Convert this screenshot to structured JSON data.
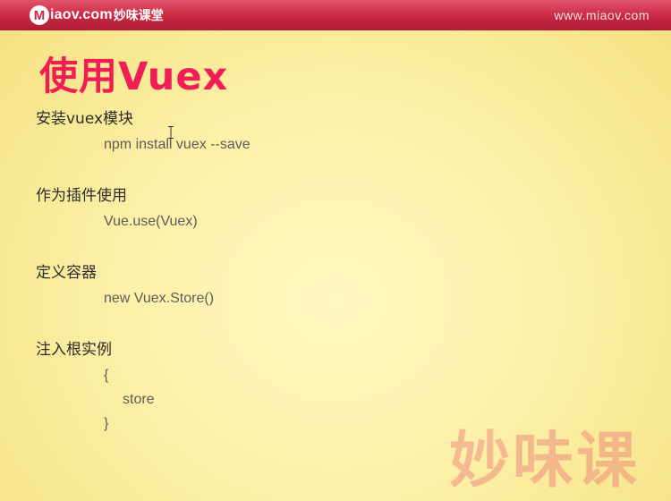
{
  "header": {
    "logo_m": "M",
    "logo_rest": "iaov.com",
    "logo_cn": "妙味课堂",
    "site_url": "www.miaov.com"
  },
  "slide": {
    "title": "使用Vuex",
    "sections": [
      {
        "heading": "安装vuex模块",
        "lines": [
          "npm install vuex --save"
        ]
      },
      {
        "heading": "作为插件使用",
        "lines": [
          "Vue.use(Vuex)"
        ]
      },
      {
        "heading": "定义容器",
        "lines": [
          "new Vuex.Store()"
        ]
      },
      {
        "heading": "注入根实例",
        "lines": [
          "{",
          "store",
          "}"
        ]
      }
    ]
  },
  "watermark": "妙味课",
  "colors": {
    "header_red": "#c82741",
    "title_pink": "#ef1e54",
    "background_yellow": "#fdf0a8"
  }
}
